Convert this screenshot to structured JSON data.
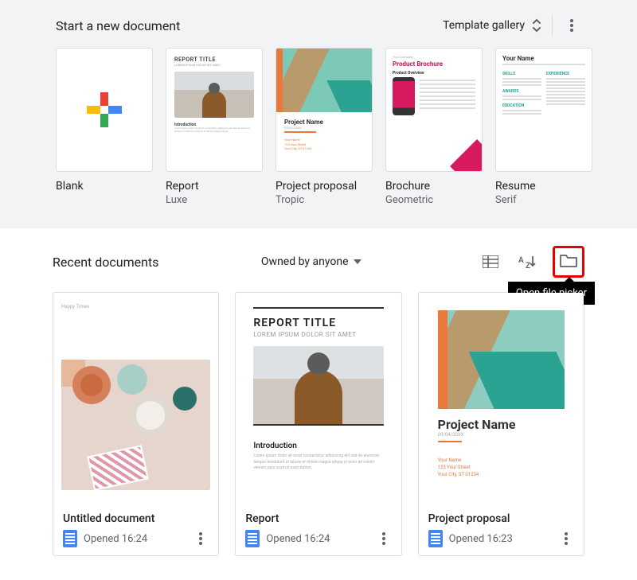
{
  "template_section": {
    "header": "Start a new document",
    "gallery_label": "Template gallery"
  },
  "templates": [
    {
      "name": "Blank",
      "sub": ""
    },
    {
      "name": "Report",
      "sub": "Luxe"
    },
    {
      "name": "Project proposal",
      "sub": "Tropic"
    },
    {
      "name": "Brochure",
      "sub": "Geometric"
    },
    {
      "name": "Resume",
      "sub": "Serif"
    }
  ],
  "recent": {
    "header": "Recent documents",
    "filter_label": "Owned by anyone",
    "tooltip": "Open file picker"
  },
  "documents": [
    {
      "title": "Untitled document",
      "opened": "Opened 16:24"
    },
    {
      "title": "Report",
      "opened": "Opened 16:24"
    },
    {
      "title": "Project proposal",
      "opened": "Opened 16:23"
    }
  ],
  "thumb_text": {
    "report_title": "REPORT TITLE",
    "report_sub": "LOREM IPSUM DOLOR SIT AMET",
    "introduction": "Introduction",
    "project_name": "Project Name",
    "project_date": "09/04/20XX",
    "brochure_company": "Your Company",
    "brochure_title": "Product Brochure",
    "brochure_overview": "Product Overview",
    "resume_name": "Your Name",
    "your_name": "Your Name",
    "your_street": "123 Your Street",
    "your_city": "Your City, ST 01234"
  }
}
